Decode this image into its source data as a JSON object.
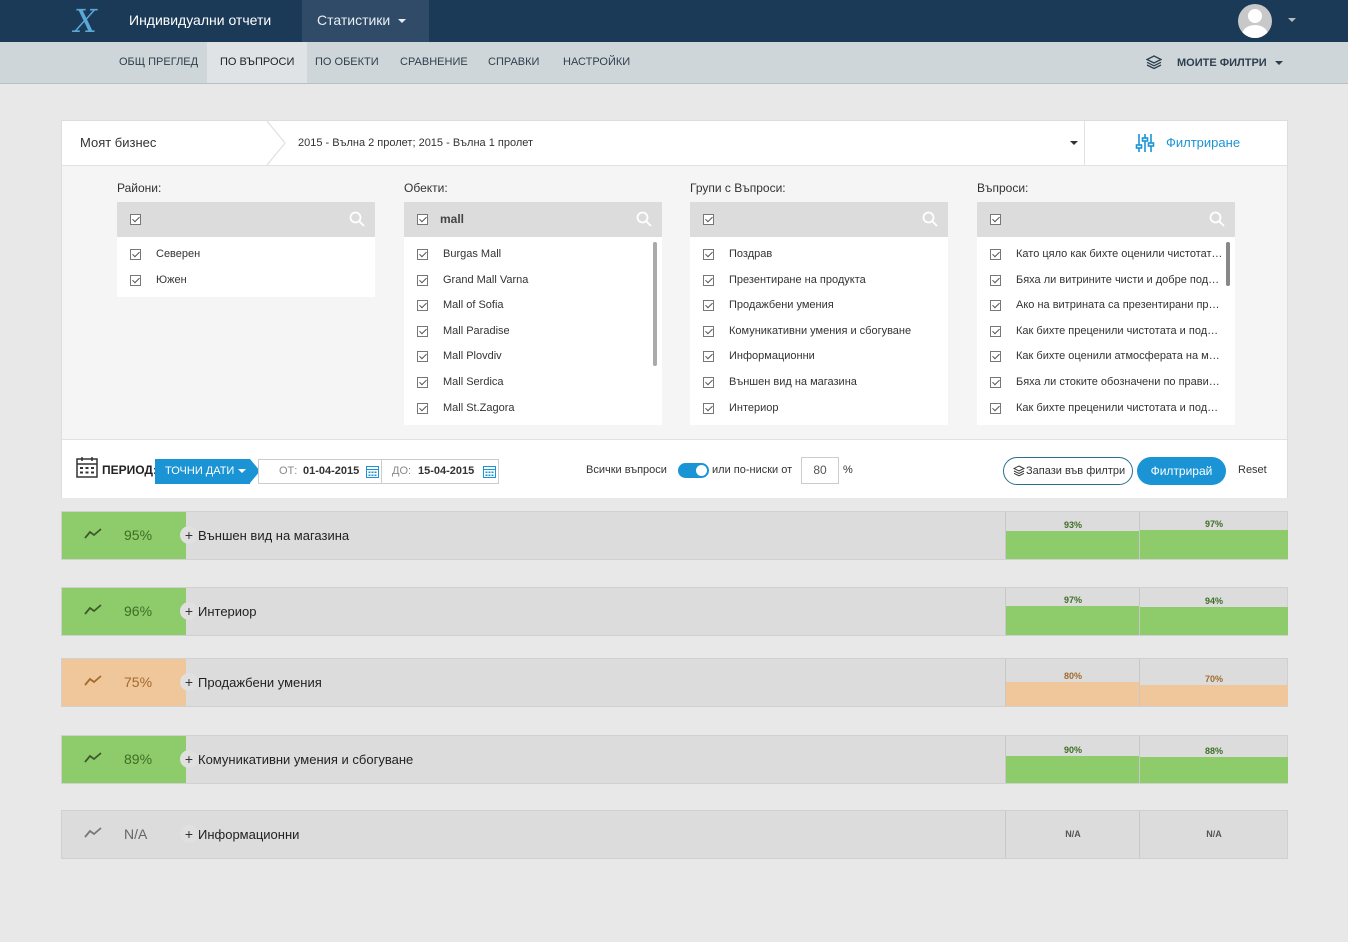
{
  "topnav": {
    "logo": "X",
    "reports": "Индивидуални отчети",
    "stats": "Статистики"
  },
  "subnav": {
    "items": [
      "Общ преглед",
      "По въпроси",
      "По обекти",
      "Сравнение",
      "Справки",
      "Настройки"
    ],
    "active_index": 1,
    "my_filters": "МОИТЕ ФИЛТРИ"
  },
  "panel": {
    "business": "Моят бизнес",
    "waves": "2015 - Вълна 2 пролет; 2015 - Вълна 1 пролет",
    "filter_label": "Филтриране",
    "columns": [
      {
        "title": "Райони:",
        "search": "",
        "items": [
          "Северен",
          "Южен"
        ]
      },
      {
        "title": "Обекти:",
        "search": "mall",
        "items": [
          "Burgas Mall",
          "Grand Mall Varna",
          "Mall of Sofia",
          "Mall Paradise",
          "Mall Plovdiv",
          "Mall Serdica",
          "Mall St.Zagora"
        ]
      },
      {
        "title": "Групи с Въпроси:",
        "search": "",
        "items": [
          "Поздрав",
          "Презентиране на продукта",
          "Продажбени умения",
          "Комуникативни умения и сбогуване",
          "Информационни",
          "Външен вид на магазина",
          "Интериор"
        ]
      },
      {
        "title": "Въпроси:",
        "search": "",
        "items": [
          "Като цяло как бихте оценили чистотата на магазина?",
          "Бяха ли витрините чисти и добре подредени?",
          "Ако на витрината са презентирани продукти, бяха ли те добре представени?",
          "Как бихте преценили чистотата и подредбата на щандовете?",
          "Как бихте оценили атмосферата на магазина?",
          "Бяха ли стоките обозначени по правилен начин?",
          "Как бихте преценили чистотата и подредбата на пробните?"
        ]
      }
    ],
    "period_label": "ПЕРИОД:",
    "dates_btn": "ТОЧНИ ДАТИ",
    "from_label": "ОТ:",
    "from_value": "01-04-2015",
    "to_label": "ДО:",
    "to_value": "15-04-2015",
    "all_questions": "Всички въпроси",
    "or_lower": "или по-ниски от",
    "threshold": "80",
    "pct_sign": "%",
    "save_filters": "Запази във филтри",
    "apply": "Филтрирай",
    "reset": "Reset"
  },
  "results": [
    {
      "name": "Външен вид на магазина",
      "score": "95%",
      "status": "good",
      "w1": "93%",
      "w2": "97%",
      "w1_level": 0.93,
      "w2_level": 0.97
    },
    {
      "name": "Интериор",
      "score": "96%",
      "status": "good",
      "w1": "97%",
      "w2": "94%",
      "w1_level": 0.97,
      "w2_level": 0.94
    },
    {
      "name": "Продажбени умения",
      "score": "75%",
      "status": "warn",
      "w1": "80%",
      "w2": "70%",
      "w1_level": 0.8,
      "w2_level": 0.7
    },
    {
      "name": "Комуникативни умения и сбогуване",
      "score": "89%",
      "status": "good",
      "w1": "90%",
      "w2": "88%",
      "w1_level": 0.9,
      "w2_level": 0.88
    },
    {
      "name": "Информационни",
      "score": "N/A",
      "status": "na",
      "w1": "N/A",
      "w2": "N/A",
      "w1_level": 0,
      "w2_level": 0
    }
  ],
  "colors": {
    "good": "#8ecb6b",
    "warn": "#efc79a",
    "na": "#dcdcdc",
    "accent": "#1a94d4"
  }
}
